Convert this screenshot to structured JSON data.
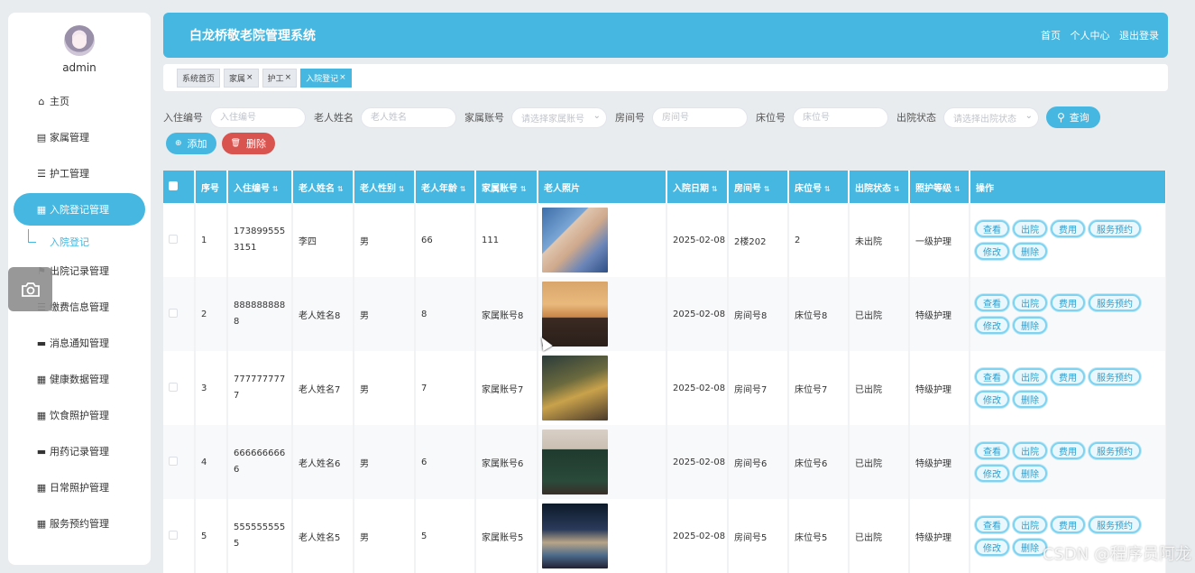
{
  "sidebar": {
    "username": "admin",
    "items": [
      {
        "label": "主页",
        "icon": "home-icon",
        "glyph": "⌂"
      },
      {
        "label": "家属管理",
        "icon": "clipboard-icon",
        "glyph": "▤"
      },
      {
        "label": "护工管理",
        "icon": "sliders-icon",
        "glyph": "☰"
      },
      {
        "label": "入院登记管理",
        "icon": "grid-icon",
        "glyph": "▦"
      },
      {
        "label": "出院记录管理",
        "icon": "flag-icon",
        "glyph": "⚑"
      },
      {
        "label": "缴费信息管理",
        "icon": "list-icon",
        "glyph": "☰"
      },
      {
        "label": "消息通知管理",
        "icon": "briefcase-icon",
        "glyph": "▬"
      },
      {
        "label": "健康数据管理",
        "icon": "grid-icon",
        "glyph": "▦"
      },
      {
        "label": "饮食照护管理",
        "icon": "grid-icon",
        "glyph": "▦"
      },
      {
        "label": "用药记录管理",
        "icon": "comment-icon",
        "glyph": "▬"
      },
      {
        "label": "日常照护管理",
        "icon": "grid-icon",
        "glyph": "▦"
      },
      {
        "label": "服务预约管理",
        "icon": "grid-icon",
        "glyph": "▦"
      }
    ],
    "active_index": 3,
    "submenu_label": "入院登记"
  },
  "header": {
    "title": "白龙桥敬老院管理系统",
    "links": [
      "首页",
      "个人中心",
      "退出登录"
    ]
  },
  "tabs": [
    {
      "label": "系统首页",
      "closable": false,
      "active": false
    },
    {
      "label": "家属",
      "closable": true,
      "active": false
    },
    {
      "label": "护工",
      "closable": true,
      "active": false
    },
    {
      "label": "入院登记",
      "closable": true,
      "active": true
    }
  ],
  "search": {
    "admission_no": {
      "label": "入住编号",
      "placeholder": "入住编号"
    },
    "elder_name": {
      "label": "老人姓名",
      "placeholder": "老人姓名"
    },
    "family_account": {
      "label": "家属账号",
      "placeholder": "请选择家属账号"
    },
    "room_no": {
      "label": "房间号",
      "placeholder": "房间号"
    },
    "bed_no": {
      "label": "床位号",
      "placeholder": "床位号"
    },
    "discharge_status": {
      "label": "出院状态",
      "placeholder": "请选择出院状态"
    },
    "search_label": "查询"
  },
  "actions": {
    "add_label": "添加",
    "delete_label": "删除"
  },
  "table": {
    "columns": [
      "序号",
      "入住编号",
      "老人姓名",
      "老人性别",
      "老人年龄",
      "家属账号",
      "老人照片",
      "入院日期",
      "房间号",
      "床位号",
      "出院状态",
      "照护等级",
      "操作"
    ],
    "row_buttons": [
      "查看",
      "出院",
      "费用",
      "服务预约",
      "修改",
      "删除"
    ],
    "rows": [
      {
        "index": "1",
        "admission_no": "1738995553151",
        "name": "李四",
        "gender": "男",
        "age": "66",
        "family": "111",
        "date": "2025-02-08",
        "room": "2楼202",
        "bed": "2",
        "status": "未出院",
        "level": "一级护理"
      },
      {
        "index": "2",
        "admission_no": "8888888888",
        "name": "老人姓名8",
        "gender": "男",
        "age": "8",
        "family": "家属账号8",
        "date": "2025-02-08",
        "room": "房间号8",
        "bed": "床位号8",
        "status": "已出院",
        "level": "特级护理"
      },
      {
        "index": "3",
        "admission_no": "7777777777",
        "name": "老人姓名7",
        "gender": "男",
        "age": "7",
        "family": "家属账号7",
        "date": "2025-02-08",
        "room": "房间号7",
        "bed": "床位号7",
        "status": "已出院",
        "level": "特级护理"
      },
      {
        "index": "4",
        "admission_no": "6666666666",
        "name": "老人姓名6",
        "gender": "男",
        "age": "6",
        "family": "家属账号6",
        "date": "2025-02-08",
        "room": "房间号6",
        "bed": "床位号6",
        "status": "已出院",
        "level": "特级护理"
      },
      {
        "index": "5",
        "admission_no": "5555555555",
        "name": "老人姓名5",
        "gender": "男",
        "age": "5",
        "family": "家属账号5",
        "date": "2025-02-08",
        "room": "房间号5",
        "bed": "床位号5",
        "status": "已出院",
        "level": "特级护理"
      }
    ]
  },
  "watermark": "CSDN @程序员阿龙",
  "colors": {
    "accent": "#45b7e0",
    "danger": "#d9534f"
  }
}
